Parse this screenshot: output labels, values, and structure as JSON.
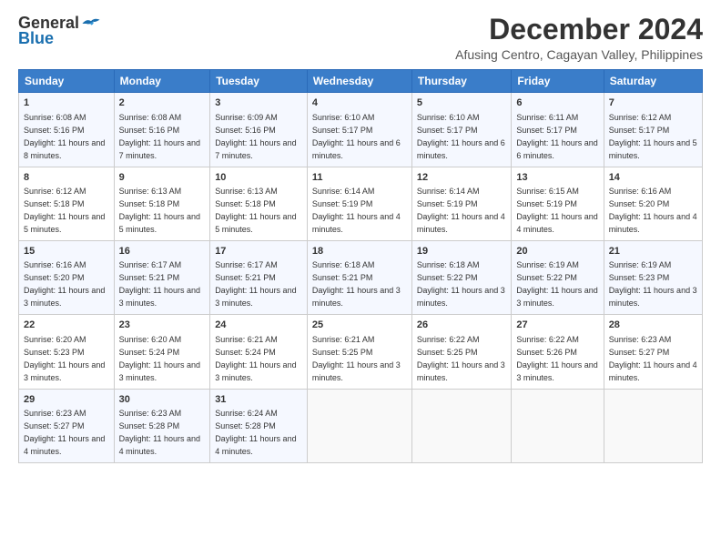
{
  "header": {
    "logo_general": "General",
    "logo_blue": "Blue",
    "title": "December 2024",
    "subtitle": "Afusing Centro, Cagayan Valley, Philippines"
  },
  "columns": [
    "Sunday",
    "Monday",
    "Tuesday",
    "Wednesday",
    "Thursday",
    "Friday",
    "Saturday"
  ],
  "weeks": [
    [
      {
        "day": "1",
        "sunrise": "6:08 AM",
        "sunset": "5:16 PM",
        "daylight": "11 hours and 8 minutes."
      },
      {
        "day": "2",
        "sunrise": "6:08 AM",
        "sunset": "5:16 PM",
        "daylight": "11 hours and 7 minutes."
      },
      {
        "day": "3",
        "sunrise": "6:09 AM",
        "sunset": "5:16 PM",
        "daylight": "11 hours and 7 minutes."
      },
      {
        "day": "4",
        "sunrise": "6:10 AM",
        "sunset": "5:17 PM",
        "daylight": "11 hours and 6 minutes."
      },
      {
        "day": "5",
        "sunrise": "6:10 AM",
        "sunset": "5:17 PM",
        "daylight": "11 hours and 6 minutes."
      },
      {
        "day": "6",
        "sunrise": "6:11 AM",
        "sunset": "5:17 PM",
        "daylight": "11 hours and 6 minutes."
      },
      {
        "day": "7",
        "sunrise": "6:12 AM",
        "sunset": "5:17 PM",
        "daylight": "11 hours and 5 minutes."
      }
    ],
    [
      {
        "day": "8",
        "sunrise": "6:12 AM",
        "sunset": "5:18 PM",
        "daylight": "11 hours and 5 minutes."
      },
      {
        "day": "9",
        "sunrise": "6:13 AM",
        "sunset": "5:18 PM",
        "daylight": "11 hours and 5 minutes."
      },
      {
        "day": "10",
        "sunrise": "6:13 AM",
        "sunset": "5:18 PM",
        "daylight": "11 hours and 5 minutes."
      },
      {
        "day": "11",
        "sunrise": "6:14 AM",
        "sunset": "5:19 PM",
        "daylight": "11 hours and 4 minutes."
      },
      {
        "day": "12",
        "sunrise": "6:14 AM",
        "sunset": "5:19 PM",
        "daylight": "11 hours and 4 minutes."
      },
      {
        "day": "13",
        "sunrise": "6:15 AM",
        "sunset": "5:19 PM",
        "daylight": "11 hours and 4 minutes."
      },
      {
        "day": "14",
        "sunrise": "6:16 AM",
        "sunset": "5:20 PM",
        "daylight": "11 hours and 4 minutes."
      }
    ],
    [
      {
        "day": "15",
        "sunrise": "6:16 AM",
        "sunset": "5:20 PM",
        "daylight": "11 hours and 3 minutes."
      },
      {
        "day": "16",
        "sunrise": "6:17 AM",
        "sunset": "5:21 PM",
        "daylight": "11 hours and 3 minutes."
      },
      {
        "day": "17",
        "sunrise": "6:17 AM",
        "sunset": "5:21 PM",
        "daylight": "11 hours and 3 minutes."
      },
      {
        "day": "18",
        "sunrise": "6:18 AM",
        "sunset": "5:21 PM",
        "daylight": "11 hours and 3 minutes."
      },
      {
        "day": "19",
        "sunrise": "6:18 AM",
        "sunset": "5:22 PM",
        "daylight": "11 hours and 3 minutes."
      },
      {
        "day": "20",
        "sunrise": "6:19 AM",
        "sunset": "5:22 PM",
        "daylight": "11 hours and 3 minutes."
      },
      {
        "day": "21",
        "sunrise": "6:19 AM",
        "sunset": "5:23 PM",
        "daylight": "11 hours and 3 minutes."
      }
    ],
    [
      {
        "day": "22",
        "sunrise": "6:20 AM",
        "sunset": "5:23 PM",
        "daylight": "11 hours and 3 minutes."
      },
      {
        "day": "23",
        "sunrise": "6:20 AM",
        "sunset": "5:24 PM",
        "daylight": "11 hours and 3 minutes."
      },
      {
        "day": "24",
        "sunrise": "6:21 AM",
        "sunset": "5:24 PM",
        "daylight": "11 hours and 3 minutes."
      },
      {
        "day": "25",
        "sunrise": "6:21 AM",
        "sunset": "5:25 PM",
        "daylight": "11 hours and 3 minutes."
      },
      {
        "day": "26",
        "sunrise": "6:22 AM",
        "sunset": "5:25 PM",
        "daylight": "11 hours and 3 minutes."
      },
      {
        "day": "27",
        "sunrise": "6:22 AM",
        "sunset": "5:26 PM",
        "daylight": "11 hours and 3 minutes."
      },
      {
        "day": "28",
        "sunrise": "6:23 AM",
        "sunset": "5:27 PM",
        "daylight": "11 hours and 4 minutes."
      }
    ],
    [
      {
        "day": "29",
        "sunrise": "6:23 AM",
        "sunset": "5:27 PM",
        "daylight": "11 hours and 4 minutes."
      },
      {
        "day": "30",
        "sunrise": "6:23 AM",
        "sunset": "5:28 PM",
        "daylight": "11 hours and 4 minutes."
      },
      {
        "day": "31",
        "sunrise": "6:24 AM",
        "sunset": "5:28 PM",
        "daylight": "11 hours and 4 minutes."
      },
      null,
      null,
      null,
      null
    ]
  ]
}
